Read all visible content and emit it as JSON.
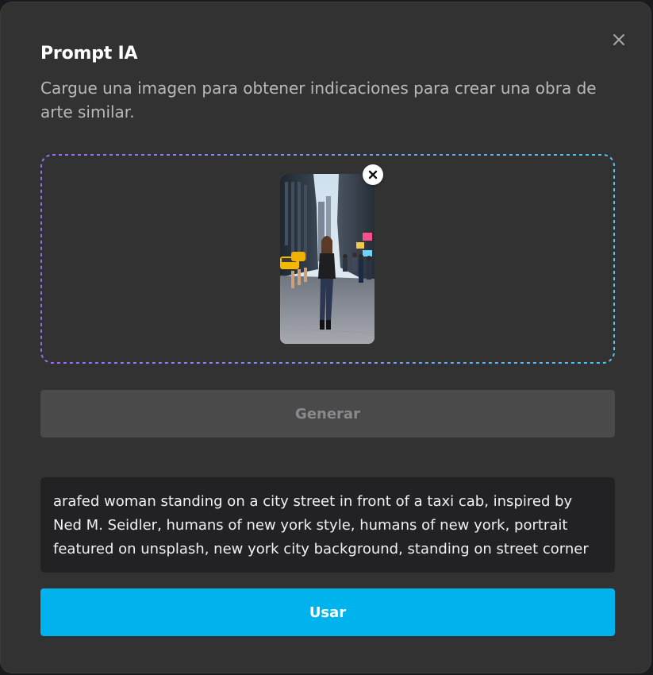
{
  "dialog": {
    "title": "Prompt IA",
    "subtitle": "Cargue una imagen para obtener indicaciones para crear una obra de arte similar.",
    "close_icon": "close-icon"
  },
  "upload": {
    "thumbnail_description_icon": "uploaded-image-thumbnail",
    "remove_icon": "close-circle-icon",
    "border_gradient": [
      "#9b6cf0",
      "#4fc3f7"
    ]
  },
  "actions": {
    "generate_label": "Generar",
    "use_label": "Usar"
  },
  "result": {
    "prompt_text": "arafed woman standing on a city street in front of a taxi cab, inspired by Ned M. Seidler, humans of new york style, humans of new york, portrait featured on unsplash, new york city background, standing on street corner"
  },
  "colors": {
    "modal_bg": "#323233",
    "primary": "#00b3ec",
    "disabled_button": "#4a4a4b",
    "text_box_bg": "#222224"
  }
}
